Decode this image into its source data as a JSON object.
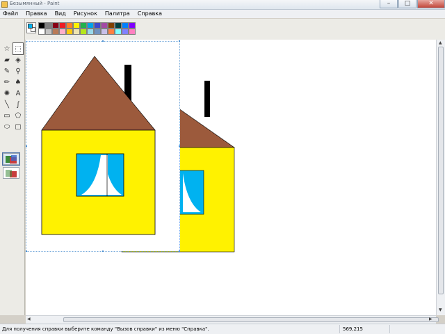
{
  "window": {
    "title": "Безымянный - Paint"
  },
  "menu": {
    "items": [
      "Файл",
      "Правка",
      "Вид",
      "Рисунок",
      "Палитра",
      "Справка"
    ]
  },
  "colors": {
    "foreground": "#00b2f0",
    "background": "#ffffff",
    "palette_top": [
      "#000000",
      "#7f7f7f",
      "#880015",
      "#ed1c24",
      "#ff7f27",
      "#fff200",
      "#22b14c",
      "#00a2e8",
      "#3f48cc",
      "#a349a4",
      "#804000",
      "#004040",
      "#0080ff",
      "#8000ff"
    ],
    "palette_bottom": [
      "#ffffff",
      "#c3c3c3",
      "#b97a57",
      "#ffaec9",
      "#ffc90e",
      "#efe4b0",
      "#b5e61d",
      "#99d9ea",
      "#7092be",
      "#c8bfe7",
      "#ff8040",
      "#80ffff",
      "#8080ff",
      "#ff80c0"
    ]
  },
  "tools": [
    {
      "name": "free-select-tool",
      "glyph": "☆",
      "selected": false
    },
    {
      "name": "rect-select-tool",
      "glyph": "⬚",
      "selected": true
    },
    {
      "name": "eraser-tool",
      "glyph": "▰",
      "selected": false
    },
    {
      "name": "fill-tool",
      "glyph": "◈",
      "selected": false
    },
    {
      "name": "color-picker-tool",
      "glyph": "✎",
      "selected": false
    },
    {
      "name": "magnifier-tool",
      "glyph": "⚲",
      "selected": false
    },
    {
      "name": "pencil-tool",
      "glyph": "✏",
      "selected": false
    },
    {
      "name": "brush-tool",
      "glyph": "♠",
      "selected": false
    },
    {
      "name": "airbrush-tool",
      "glyph": "✺",
      "selected": false
    },
    {
      "name": "text-tool",
      "glyph": "A",
      "selected": false
    },
    {
      "name": "line-tool",
      "glyph": "╲",
      "selected": false
    },
    {
      "name": "curve-tool",
      "glyph": "∫",
      "selected": false
    },
    {
      "name": "rectangle-tool",
      "glyph": "▭",
      "selected": false
    },
    {
      "name": "polygon-tool",
      "glyph": "⬠",
      "selected": false
    },
    {
      "name": "ellipse-tool",
      "glyph": "⬭",
      "selected": false
    },
    {
      "name": "rounded-rect-tool",
      "glyph": "▢",
      "selected": false
    }
  ],
  "status": {
    "help": "Для получения справки выберите команду \"Вызов справки\" из меню \"Справка\".",
    "coords": "569,215"
  }
}
